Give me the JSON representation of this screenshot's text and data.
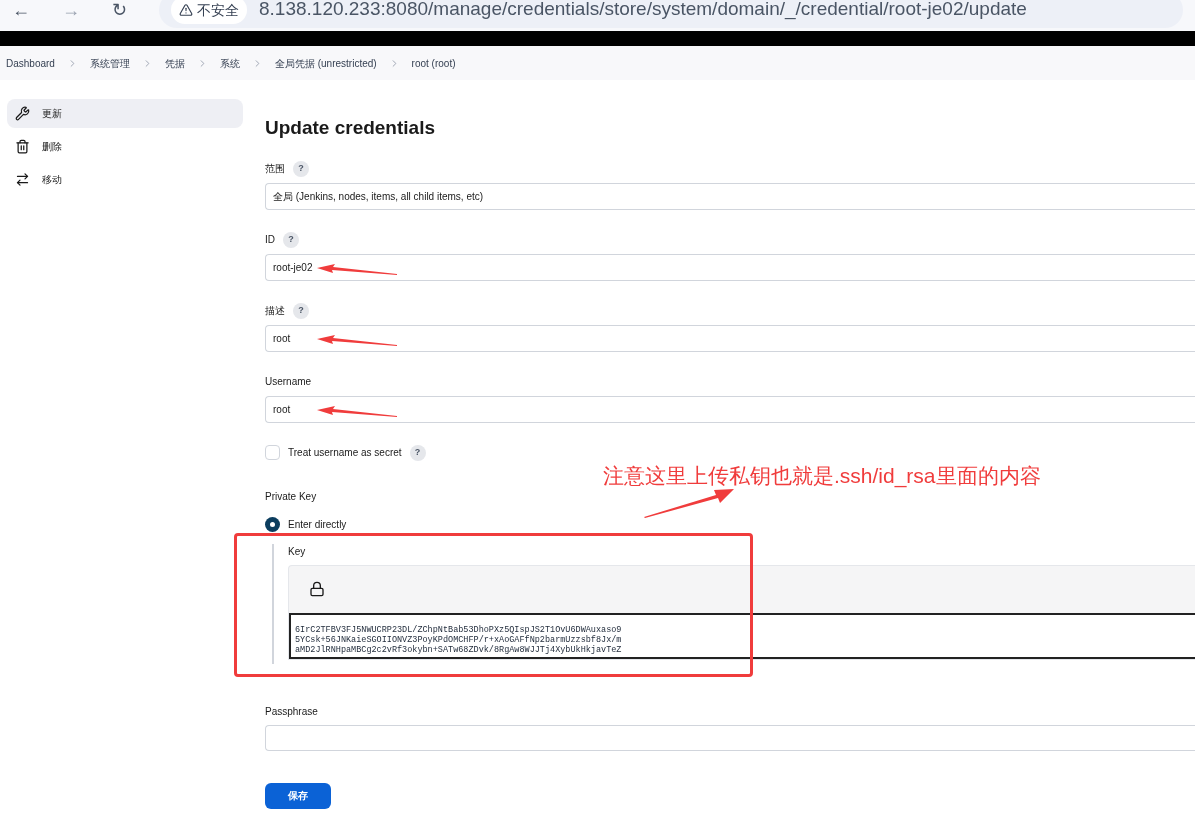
{
  "browser": {
    "nav": [
      "←",
      "→",
      "↻"
    ],
    "security": "不安全",
    "url": "8.138.120.233:8080/manage/credentials/store/system/domain/_/credential/root-je02/update"
  },
  "breadcrumbs": [
    "Dashboard",
    "系统管理",
    "凭据",
    "系统",
    "全局凭据 (unrestricted)",
    "root (root)"
  ],
  "sidebar": {
    "items": [
      {
        "label": "更新",
        "selected": true
      },
      {
        "label": "删除",
        "selected": false
      },
      {
        "label": "移动",
        "selected": false
      }
    ]
  },
  "form": {
    "title": "Update credentials",
    "fields": [
      {
        "label": "范围",
        "help": "?",
        "value": "全局 (Jenkins, nodes, items, all child items, etc)",
        "arrow": false
      },
      {
        "label": "ID",
        "help": "?",
        "value": "root-je02",
        "arrow": true
      },
      {
        "label": "描述",
        "help": "?",
        "value": "root",
        "arrow": true
      },
      {
        "label": "Username",
        "value": "root",
        "arrow": true
      }
    ],
    "secret_checkbox": {
      "label": "Treat username as secret",
      "help": "?",
      "checked": false
    },
    "private_key": {
      "label": "Private Key",
      "option": {
        "label": "Enter directly",
        "selected": true
      },
      "key_label": "Key",
      "key_lines": [
        "6IrC2TFBV3FJ5NWUCRP23DL/ZChpNtBab53DhoPXz5QIspJS2T1OvU6DWAuxaso9",
        "5YCsk+56JNKaieSGOIIONVZ3PoyKPdOMCHFP/r+xAoGAFfNp2barmUzzsbf8Jx/m",
        "aMD2JlRNHpaMBCg2c2vRf3okybn+SATw68ZDvk/8RgAw8WJJTj4XybUkHkjavTeZ"
      ]
    },
    "passphrase": {
      "label": "Passphrase"
    },
    "save_button": "保存"
  },
  "annotation": {
    "text": "注意这里上传私钥也就是.ssh/id_rsa里面的内容"
  }
}
